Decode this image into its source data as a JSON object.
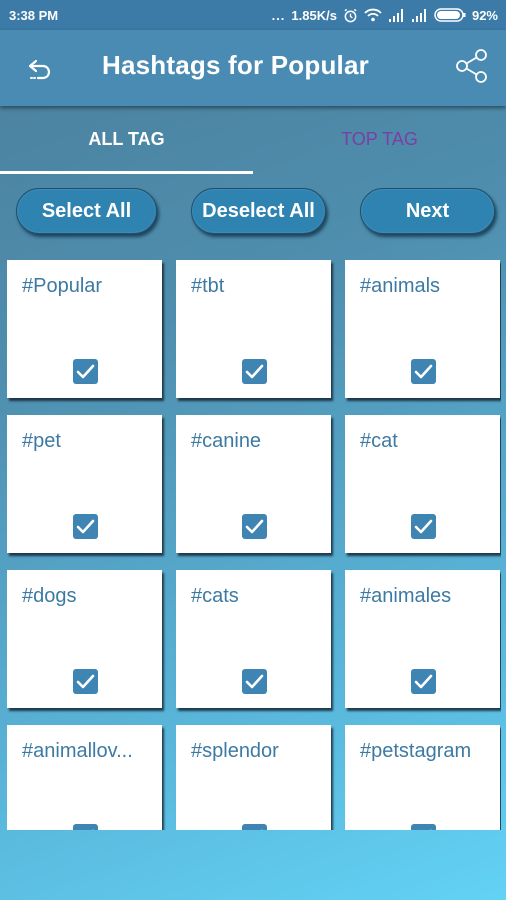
{
  "status_bar": {
    "time": "3:38 PM",
    "more": "...",
    "network_speed": "1.85K/s",
    "battery": "92%",
    "icons": [
      "alarm-icon",
      "wifi-icon",
      "signal-icon",
      "signal-icon",
      "battery-icon"
    ]
  },
  "app_bar": {
    "title": "Hashtags for Popular",
    "back_icon": "undo-arrow-icon",
    "share_icon": "share-icon"
  },
  "tabs": [
    {
      "label": "ALL TAG",
      "active": true
    },
    {
      "label": "TOP TAG",
      "active": false
    }
  ],
  "actions": {
    "select_all": "Select All",
    "deselect_all": "Deselect All",
    "next": "Next"
  },
  "tags": [
    {
      "label": "#Popular",
      "checked": true
    },
    {
      "label": "#tbt",
      "checked": true
    },
    {
      "label": "#animals",
      "checked": true
    },
    {
      "label": "#pet",
      "checked": true
    },
    {
      "label": "#canine",
      "checked": true
    },
    {
      "label": "#cat",
      "checked": true
    },
    {
      "label": "#dogs",
      "checked": true
    },
    {
      "label": "#cats",
      "checked": true
    },
    {
      "label": "#animales",
      "checked": true
    },
    {
      "label": "#animallov...",
      "checked": true
    },
    {
      "label": "#splendor",
      "checked": true
    },
    {
      "label": "#petstagram",
      "checked": true
    }
  ],
  "colors": {
    "app_bar": "#4a8bb3",
    "status_bar": "#3c7ba8",
    "accent_text": "#3d7aa3",
    "inactive_tab": "#7a3fa4",
    "checkbox": "#3f85b4",
    "button": "#2f83b1"
  }
}
